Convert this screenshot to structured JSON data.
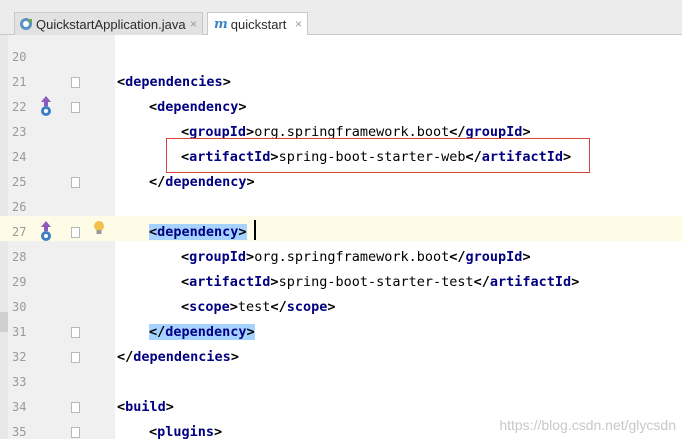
{
  "tabs": [
    {
      "label": "QuickstartApplication.java",
      "icon": "spring-class-icon",
      "close": "×"
    },
    {
      "label": "quickstart",
      "icon": "maven-icon",
      "icon_glyph": "m",
      "close": "×"
    }
  ],
  "editor": {
    "lines": [
      {
        "num": "20"
      },
      {
        "num": "21",
        "code": "<dependencies>"
      },
      {
        "num": "22",
        "code": "<dependency>"
      },
      {
        "num": "23",
        "code": "<groupId>org.springframework.boot</groupId>"
      },
      {
        "num": "24",
        "code": "<artifactId>spring-boot-starter-web</artifactId>"
      },
      {
        "num": "25",
        "code": "</dependency>"
      },
      {
        "num": "26"
      },
      {
        "num": "27",
        "code": "<dependency>"
      },
      {
        "num": "28",
        "code": "<groupId>org.springframework.boot</groupId>"
      },
      {
        "num": "29",
        "code": "<artifactId>spring-boot-starter-test</artifactId>"
      },
      {
        "num": "30",
        "code": "<scope>test</scope>"
      },
      {
        "num": "31",
        "code": "</dependency>"
      },
      {
        "num": "32",
        "code": "</dependencies>"
      },
      {
        "num": "33"
      },
      {
        "num": "34",
        "code": "<build>"
      },
      {
        "num": "35",
        "code": "<plugins>"
      }
    ],
    "values": {
      "group_id": "org.springframework.boot",
      "artifact_web": "spring-boot-starter-web",
      "artifact_test": "spring-boot-starter-test",
      "scope": "test"
    }
  },
  "watermark": "https://blog.csdn.net/glycsdn",
  "colors": {
    "tag": "#000080",
    "selection": "#a6d2ff",
    "current_line": "#fefbe6",
    "highlight_box": "#d9443a"
  }
}
